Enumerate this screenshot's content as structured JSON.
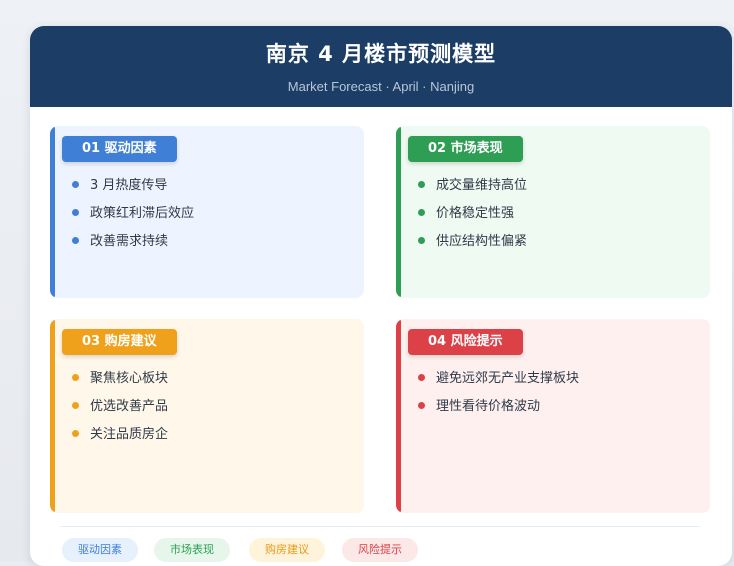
{
  "header": {
    "title": "南京 4 月楼市预测模型",
    "subtitle": "Market Forecast · April · Nanjing"
  },
  "panels": [
    {
      "tag": "01 驱动因素",
      "color": "#3f7fd5",
      "items": [
        "3 月热度传导",
        "政策红利滞后效应",
        "改善需求持续"
      ]
    },
    {
      "tag": "02 市场表现",
      "color": "#2f9e55",
      "items": [
        "成交量维持高位",
        "价格稳定性强",
        "供应结构性偏紧"
      ]
    },
    {
      "tag": "03 购房建议",
      "color": "#f0a11c",
      "items": [
        "聚焦核心板块",
        "优选改善产品",
        "关注品质房企"
      ]
    },
    {
      "tag": "04 风险提示",
      "color": "#dc4148",
      "items": [
        "避免远郊无产业支撑板块",
        "理性看待价格波动"
      ]
    }
  ],
  "legend": [
    "驱动因素",
    "市场表现",
    "购房建议",
    "风险提示"
  ]
}
